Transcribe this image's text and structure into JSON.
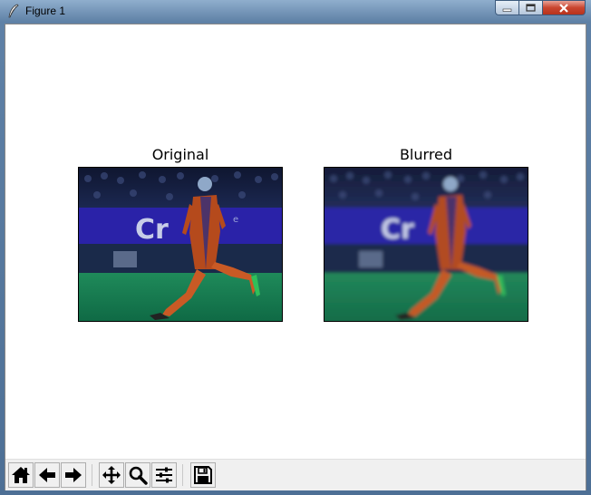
{
  "window": {
    "title": "Figure 1"
  },
  "figure": {
    "axes": [
      {
        "title": "Original"
      },
      {
        "title": "Blurred"
      }
    ]
  },
  "toolbar": {
    "buttons": [
      {
        "icon": "home-icon"
      },
      {
        "icon": "back-arrow-icon"
      },
      {
        "icon": "forward-arrow-icon"
      },
      {
        "icon": "pan-move-icon"
      },
      {
        "icon": "zoom-magnifier-icon"
      },
      {
        "icon": "configure-subplots-icon"
      },
      {
        "icon": "save-floppy-icon"
      }
    ]
  }
}
